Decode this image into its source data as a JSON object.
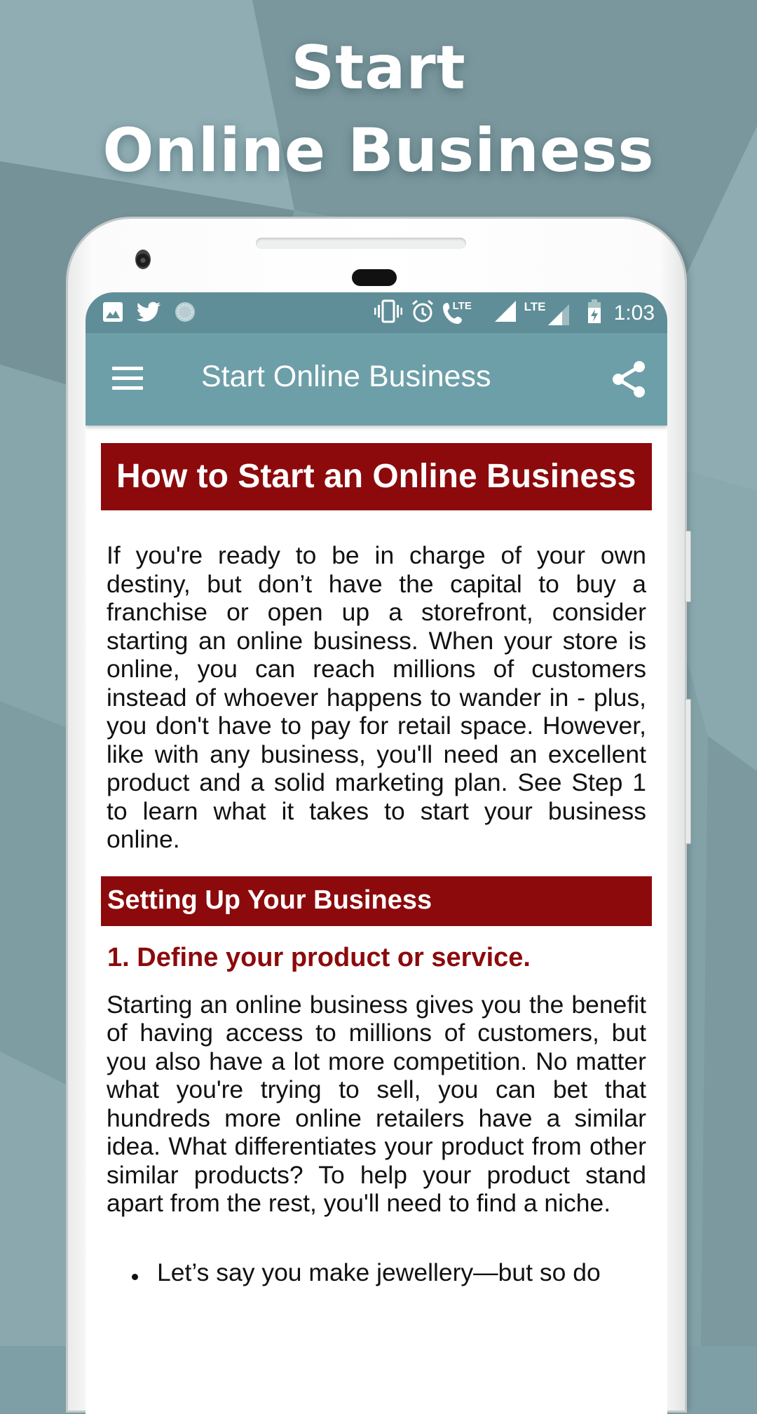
{
  "promo": {
    "title_line1": "Start",
    "title_line2": "Online Business"
  },
  "colors": {
    "background": "#7f9fa6",
    "status_bar": "#5f8e98",
    "app_bar": "#6d9fa8",
    "accent_red": "#8c0a0c",
    "body_text": "#111111"
  },
  "status_bar": {
    "left_icons": [
      "image-icon",
      "twitter-icon",
      "sync-icon"
    ],
    "right_icons": [
      "vibrate-icon",
      "alarm-icon",
      "volte-call-icon",
      "signal-icon",
      "lte-signal-icon",
      "battery-charging-icon"
    ],
    "lte_label_1": "LTE",
    "lte_label_2": "LTE",
    "time": "1:03"
  },
  "app_bar": {
    "title": "Start Online Business",
    "menu_icon": "hamburger-menu-icon",
    "share_icon": "share-icon"
  },
  "article": {
    "title": "How to Start an Online Business",
    "intro": "If you're ready to be in charge of your own destiny, but don’t have the capital to buy a franchise or open up a storefront, consider starting an online business. When your store is online, you can reach millions of customers instead of whoever happens to wander in - plus, you don't have to pay for retail space. However, like with any business, you'll need an excellent product and a solid marketing plan. See Step 1 to learn what it takes to start your business online.",
    "section_title": "Setting Up Your Business",
    "step1_heading": "1. Define your product or service.",
    "step1_body": "Starting an online business gives you the benefit of having access to millions of customers, but you also have a lot more competition. No matter what you're trying to sell, you can bet that hundreds more online retailers have a similar idea. What differentiates your product from other similar products? To help your product stand apart from the rest, you'll need to find a niche.",
    "bullet_1": "Let’s say you make jewellery—but so do"
  }
}
